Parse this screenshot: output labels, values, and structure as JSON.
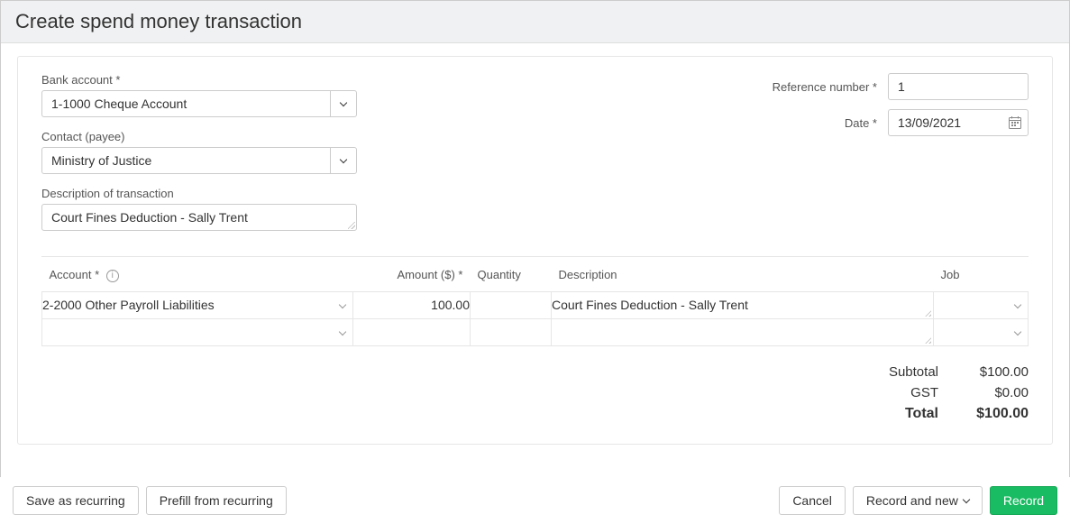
{
  "header": {
    "title": "Create spend money transaction"
  },
  "labels": {
    "bank_account": "Bank account *",
    "contact": "Contact (payee)",
    "description": "Description of transaction",
    "reference": "Reference number *",
    "date": "Date *"
  },
  "fields": {
    "bank_account": "1-1000 Cheque Account",
    "contact": "Ministry of Justice",
    "description": "Court Fines Deduction - Sally Trent",
    "reference": "1",
    "date": "13/09/2021"
  },
  "table": {
    "headers": {
      "account": "Account *",
      "amount": "Amount ($) *",
      "quantity": "Quantity",
      "description": "Description",
      "job": "Job"
    },
    "rows": [
      {
        "account": "2-2000 Other Payroll Liabilities",
        "amount": "100.00",
        "quantity": "",
        "description": "Court Fines Deduction - Sally Trent",
        "job": ""
      },
      {
        "account": "",
        "amount": "",
        "quantity": "",
        "description": "",
        "job": ""
      }
    ]
  },
  "totals": {
    "subtotal_label": "Subtotal",
    "subtotal": "$100.00",
    "gst_label": "GST",
    "gst": "$0.00",
    "total_label": "Total",
    "total": "$100.00"
  },
  "footer": {
    "save_recurring": "Save as recurring",
    "prefill": "Prefill from recurring",
    "cancel": "Cancel",
    "record_new": "Record and new",
    "record": "Record"
  }
}
